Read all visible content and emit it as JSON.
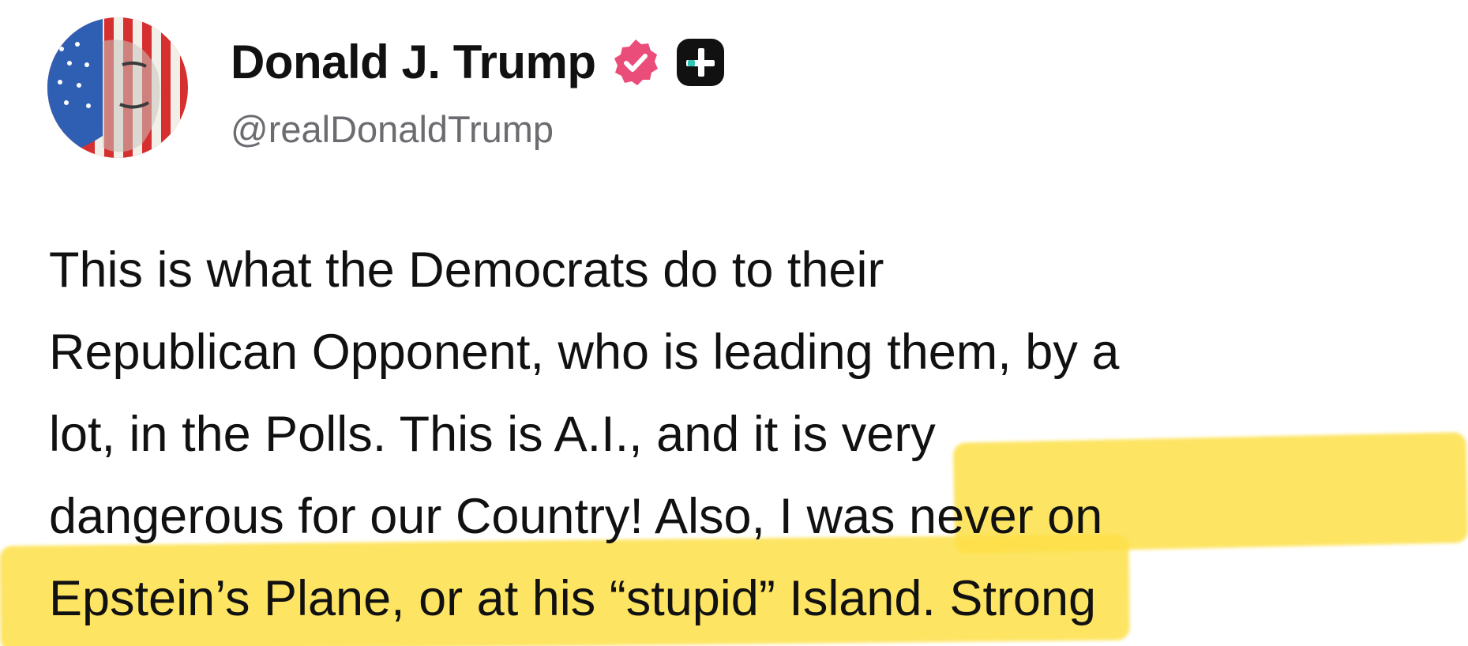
{
  "post": {
    "author": {
      "display_name": "Donald J. Trump",
      "handle": "@realDonaldTrump",
      "verified_badge_color": "#ea4d7a",
      "verified_icon": "verified-badge-icon",
      "plus_icon": "plus-badge-icon"
    },
    "body_lines": [
      "This is what the Democrats do to their",
      "Republican Opponent, who is leading them, by a",
      "lot, in the Polls. This is A.I., and it is very",
      "dangerous for our Country! Also, I was never on",
      "Epstein’s Plane, or at his “stupid” Island. Strong"
    ],
    "highlight_color": "#fde047",
    "highlighted_text": "I was never on Epstein’s Plane, or at his “stupid” Island"
  }
}
